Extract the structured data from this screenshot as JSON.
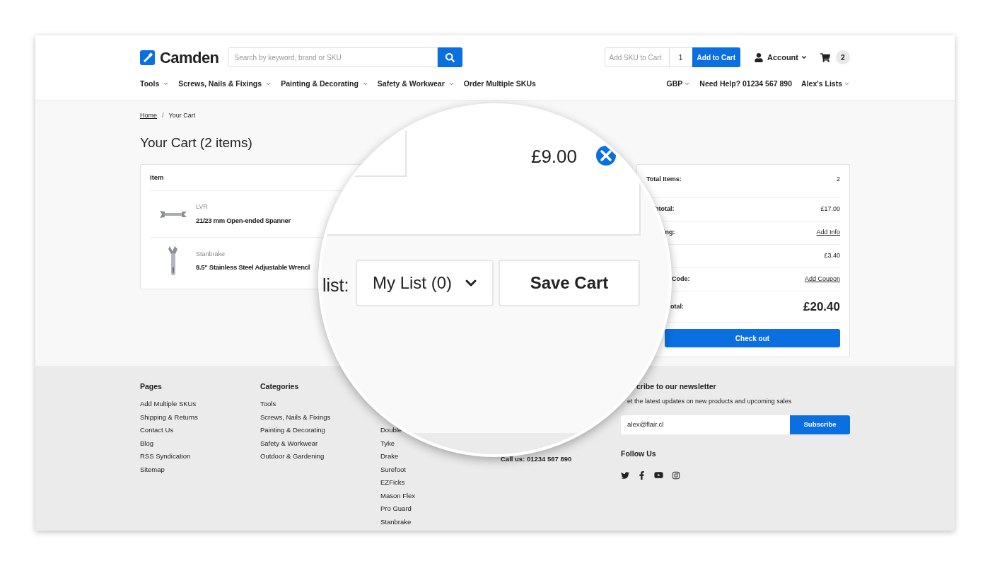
{
  "header": {
    "logo": "Camden",
    "search": {
      "placeholder": "Search by keyword, brand or SKU"
    },
    "quick_add": {
      "sku_placeholder": "Add SKU to Cart",
      "quantity": "1",
      "button": "Add to Cart"
    },
    "account": "Account",
    "cart_count": "2"
  },
  "nav": {
    "left": [
      {
        "label": "Tools",
        "has_menu": true
      },
      {
        "label": "Screws, Nails & Fixings",
        "has_menu": true
      },
      {
        "label": "Painting & Decorating",
        "has_menu": true
      },
      {
        "label": "Safety & Workwear",
        "has_menu": true
      },
      {
        "label": "Order Multiple SKUs",
        "has_menu": false
      }
    ],
    "right": [
      {
        "label": "GBP",
        "has_menu": true
      },
      {
        "label": "Need Help? 01234 567 890",
        "has_menu": false
      },
      {
        "label": "Alex's Lists",
        "has_menu": true
      }
    ]
  },
  "breadcrumb": [
    "Home",
    "Your Cart"
  ],
  "breadcrumb_separator": "/",
  "title": "Your Cart (2 items)",
  "cart": {
    "column": "Item",
    "items": [
      {
        "brand": "LVR",
        "name": "21/23 mm Open-ended Spanner",
        "kind": "spanner"
      },
      {
        "brand": "Stanbrake",
        "name": "8.5\" Stainless Steel Adjustable Wrencl",
        "kind": "wrench"
      }
    ]
  },
  "summary": {
    "rows": [
      {
        "label": "Total Items:",
        "value": "2",
        "kind": "text"
      },
      {
        "label": "btotal:",
        "value": "£17.00",
        "kind": "text"
      },
      {
        "label": "ing:",
        "value": "Add Info",
        "kind": "link"
      },
      {
        "value": "£3.40",
        "kind": "text"
      },
      {
        "label": "Code:",
        "value": "Add Coupon",
        "kind": "link"
      },
      {
        "label": "otal:",
        "value": "£20.40",
        "kind": "total"
      }
    ],
    "button": "Check out"
  },
  "magnifier": {
    "price": "£9.00",
    "list_label": "list:",
    "list_select": "My List (0)",
    "save_button": "Save Cart"
  },
  "footer": {
    "columns": [
      {
        "heading": "Pages",
        "links": [
          "Add Multiple SKUs",
          "Shipping & Returns",
          "Contact Us",
          "Blog",
          "RSS Syndication",
          "Sitemap"
        ]
      },
      {
        "heading": "Categories",
        "links": [
          "Tools",
          "Screws, Nails & Fixings",
          "Painting & Decorating",
          "Safety & Workwear",
          "Outdoor & Gardening"
        ]
      },
      {
        "links": [
          "Double",
          "Tyke",
          "Drake",
          "Surefoot",
          "EZFicks",
          "Mason Flex",
          "Pro Guard",
          "Stanbrake"
        ]
      },
      {
        "links": [
          "Call us: 01234 567 890"
        ]
      }
    ],
    "newsletter": {
      "heading": "cribe to our newsletter",
      "text": "et the latest updates on new products and upcoming sales",
      "email": "alex@flair.cl",
      "button": "Subscribe"
    },
    "follow": {
      "heading": "Follow Us"
    }
  }
}
